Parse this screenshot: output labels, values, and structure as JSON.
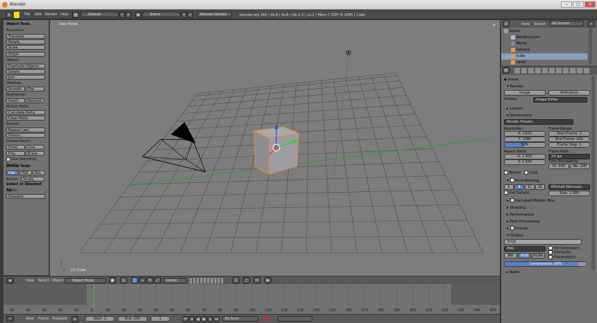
{
  "title": "Blender",
  "menu": [
    "File",
    "Add",
    "Render",
    "Help"
  ],
  "layout": "Default",
  "scene": "Scene",
  "engine": "Blender Render",
  "status": "blender.org 260 | Ve:8 | Fa:6 | Ob:1-3 | La:1 | Mem:7.15M (0.10M) | Cube",
  "toolshelf": {
    "title": "Object Tools",
    "transform": "Transform:",
    "translate": "Translate",
    "rotate": "Rotate",
    "scale": "Scale",
    "origin": "Origin",
    "object": "Object:",
    "duplicate": "Duplicate Objects",
    "delete": "Delete",
    "join": "Join",
    "shading": "Shading:",
    "smooth": "Smooth",
    "flat": "Flat",
    "keyframes": "Keyframes:",
    "insert": "Insert",
    "remove": "Remove",
    "motion_paths": "Motion Paths:",
    "calc_paths": "Calculate Paths",
    "clear_paths": "Clear Paths",
    "repeat": "Repeat:",
    "repeat_last": "Repeat Last",
    "history": "History...",
    "grease": "Grease Pencil:",
    "draw": "Draw",
    "line": "Line",
    "poly": "Poly",
    "erase": "Erase",
    "sketch": "Use Sketching Sessio",
    "unreal": "Unreal Tools",
    "psk": "PSK",
    "psa": "PSA",
    "all": "ALL",
    "action": "Action:",
    "single": "Single",
    "select_deselect": "Select or Deselect All",
    "action2": "Action:",
    "deselect": "Deselect"
  },
  "viewport": {
    "label": "User Persp",
    "obj_label": "(1) Cube"
  },
  "vpheader": {
    "view": "View",
    "select": "Select",
    "object": "Object",
    "mode": "Object Mode",
    "orientation": "Global"
  },
  "timeline": {
    "ticks": [
      "-50",
      "-40",
      "-30",
      "-20",
      "-10",
      "0",
      "10",
      "20",
      "30",
      "40",
      "50",
      "60",
      "70",
      "80",
      "90",
      "100",
      "110",
      "120",
      "130",
      "140",
      "150",
      "160",
      "170",
      "180",
      "190",
      "200",
      "210",
      "220",
      "230",
      "240",
      "250"
    ],
    "current": 1,
    "view": "View",
    "frame": "Frame",
    "playback": "Playback",
    "start": "Start: 1",
    "end": "End: 250",
    "cur_label": "1",
    "sync": "No Sync"
  },
  "outliner": {
    "view": "View",
    "search": "Search",
    "filter": "All Scenes",
    "items": [
      "Scene",
      "RenderLayers",
      "World",
      "Camera",
      "Cube",
      "Lamp"
    ]
  },
  "props": {
    "scene": "Scene",
    "render": "Render",
    "image": "Image",
    "animation": "Animation",
    "display": "Display:",
    "display_val": "Image Editor",
    "layers": "Layers",
    "dimensions": "Dimensions",
    "presets": "Render Presets",
    "resolution": "Resolution:",
    "resx": "X: 1920",
    "resy": "Y: 1080",
    "respct": "50%",
    "frame_range": "Frame Range:",
    "start": "Start Frame: 1",
    "end": "End Frame: 250",
    "step": "Frame Step: 1",
    "aspect": "Aspect Ratio:",
    "ax": "X: 1.000",
    "ay": "Y: 1.000",
    "fps_label": "Frame Rate:",
    "fps": "24 fps",
    "remap": "Time Remapping:",
    "old": "Ol: 100",
    "new": "Ne: 100",
    "border": "Border",
    "crop": "Crop",
    "aa": "Anti-Aliasing",
    "aa_vals": [
      "5",
      "8",
      "11",
      "16"
    ],
    "filter": "Mitchell-Netravali",
    "full_sample": "Full Sample",
    "size": "Size: 1.000",
    "motion_blur": "Sampled Motion Blur",
    "shading": "Shading",
    "performance": "Performance",
    "post": "Post Processing",
    "stamp": "Stamp",
    "output": "Output",
    "path": "/tmp\\",
    "format": "PNG",
    "file_ext": "File Extensions",
    "overwrite": "Overwrite",
    "placeholders": "Placeholders",
    "bw": "BW",
    "rgb": "RGB",
    "rgba": "RGBA",
    "compression": "Compression: 90%",
    "bake": "Bake"
  }
}
